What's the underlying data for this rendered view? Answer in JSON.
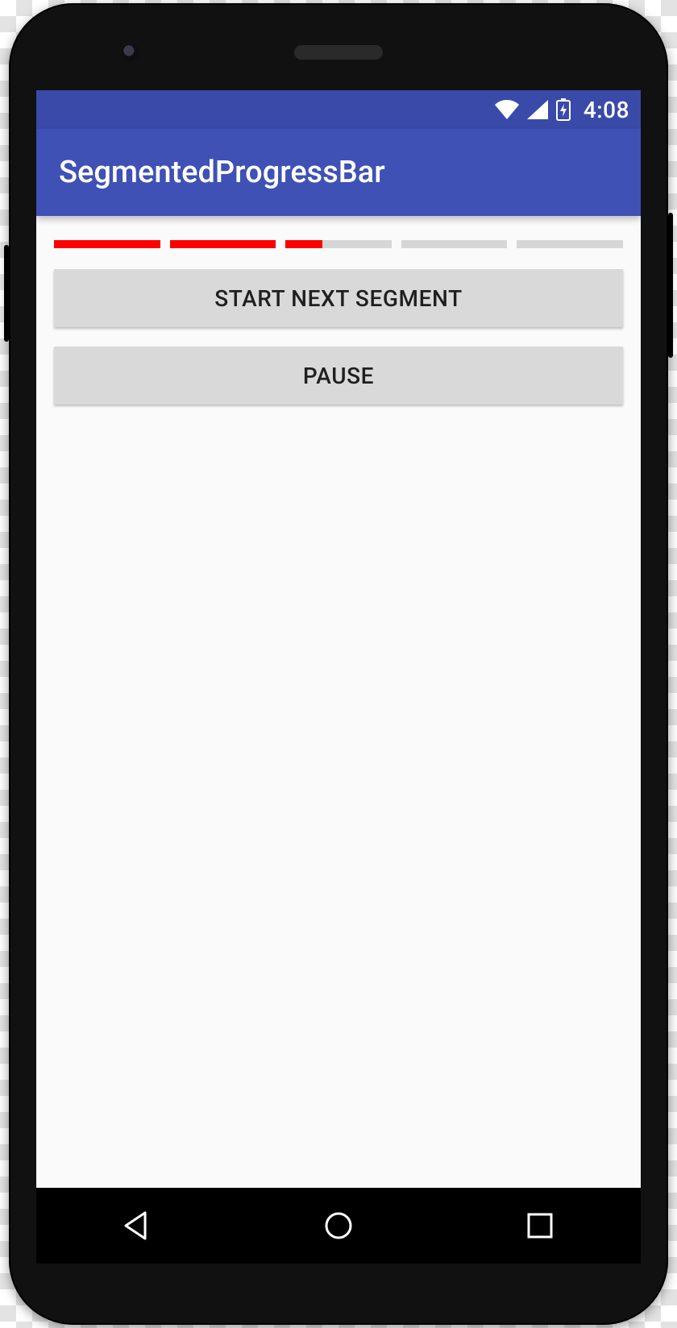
{
  "status": {
    "time": "4:08"
  },
  "appbar": {
    "title": "SegmentedProgressBar"
  },
  "progress": {
    "segment_count": 5,
    "fill_color": "#ff0000",
    "empty_color": "#d6d6d6",
    "segments_pct": [
      100,
      100,
      35,
      0,
      0
    ]
  },
  "buttons": {
    "start_next": "START NEXT SEGMENT",
    "pause": "PAUSE"
  }
}
